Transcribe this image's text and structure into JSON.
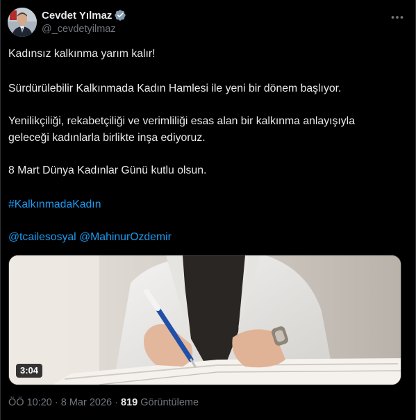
{
  "author": {
    "display_name": "Cevdet Yılmaz",
    "handle": "@_cevdetyilmaz",
    "verified_icon": "verified-badge-icon"
  },
  "tweet": {
    "lines": [
      "Kadınsız kalkınma yarım kalır!",
      "Sürdürülebilir Kalkınmada Kadın Hamlesi ile yeni bir dönem başlıyor.",
      "Yenilikçiliği, rekabetçiliği ve verimliliği esas alan bir kalkınma anlayışıyla",
      "geleceği kadınlarla birlikte inşa ediyoruz.",
      "8 Mart Dünya Kadınlar Günü kutlu olsun."
    ],
    "hashtag": "#KalkınmadaKadın",
    "mention_1": "@tcailesosyal",
    "mention_2": "@MahinurOzdemir"
  },
  "media": {
    "duration": "3:04"
  },
  "meta": {
    "timestamp": "ÖÖ 10:20 · 8 Mar 2026 · ",
    "views_count": "819",
    "views_label": " Görüntüleme"
  },
  "colors": {
    "background": "#000000",
    "text": "#e7e9ea",
    "secondary_text": "#71767b",
    "link": "#1d9bf0"
  }
}
